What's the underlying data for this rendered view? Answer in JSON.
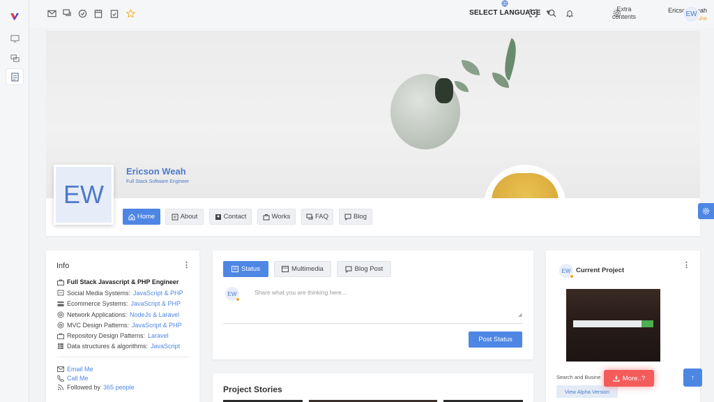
{
  "topbar": {
    "language_label": "SELECT LANGUAGE",
    "extra_line1": "Extra",
    "extra_line2": "contents",
    "user_name": "Ericson Weah",
    "user_status": "Is offline",
    "user_initials": "EW"
  },
  "profile": {
    "initials": "EW",
    "name": "Ericson Weah",
    "title": "Full Stack Software Engineer",
    "nav": [
      "Home",
      "About",
      "Contact",
      "Works",
      "FAQ",
      "Blog"
    ]
  },
  "info": {
    "title": "Info",
    "headline": "Full Stack Javascript & PHP Engineer",
    "rows": [
      {
        "label": "Social Media Systems:",
        "value": "JavaScript & PHP"
      },
      {
        "label": "Ecommerce Systems:",
        "value": "JavaScript & PHP"
      },
      {
        "label": "Network Applications:",
        "value": "NodeJs & Laravel"
      },
      {
        "label": "MVC Design Patterns:",
        "value": "JavaScript & PHP"
      },
      {
        "label": "Repository Design Patterns:",
        "value": "Laravel"
      },
      {
        "label": "Data structures & algorithms:",
        "value": "JavaScript"
      }
    ],
    "email": "Email Me",
    "call": "Call Me",
    "followed_prefix": "Followed by",
    "followed_count": "365 people"
  },
  "post": {
    "tabs": [
      "Status",
      "Multimedia",
      "Blog Post"
    ],
    "initials": "EW",
    "placeholder": "Share what you are thinking here...",
    "button": "Post Status"
  },
  "stories": {
    "title": "Project Stories"
  },
  "project": {
    "initials": "EW",
    "title": "Current Project",
    "description": "Search and Busine",
    "alpha_button": "View Alpha Version"
  },
  "floating": {
    "more": "More..?",
    "top_arrow": "↑"
  },
  "colors": {
    "accent": "#4e86e4",
    "danger": "#f45b5b",
    "offline": "#e8a33d"
  }
}
